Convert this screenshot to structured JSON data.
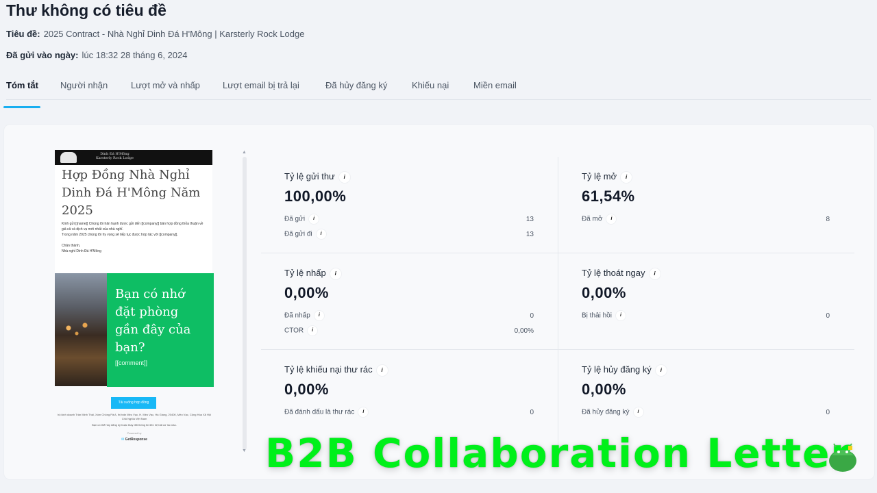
{
  "header": {
    "title": "Thư không có tiêu đề",
    "subject_label": "Tiêu đề:",
    "subject_value": "2025 Contract - Nhà Nghỉ Dinh Đá H'Mông | Karsterly Rock Lodge",
    "sent_label": "Đã gửi vào ngày:",
    "sent_value": "lúc 18:32 28 tháng 6, 2024"
  },
  "tabs": [
    "Tóm tắt",
    "Người nhận",
    "Lượt mở và nhấp",
    "Lượt email bị trả lại",
    "Đã hủy đăng ký",
    "Khiếu nại",
    "Miền email"
  ],
  "active_tab": "Tóm tắt",
  "preview": {
    "brand": "Dinh Đá H'Mông\nKarsterly Rock Lodge",
    "heading": "Hợp Đồng Nhà Nghỉ Dinh Đá H'Mông Năm 2025",
    "body_line1": "Kính gửi [[name]] Chúng tôi hân hạnh được gửi đến [[company]] bản hợp đồng thỏa thuận về giá cả và dịch vụ mới nhất của nhà nghỉ.",
    "body_line2": "Trong năm 2025 chúng tôi hy vọng sẽ tiếp tục được hợp tác với [[company]].",
    "body_line3": "Chân thành,",
    "body_line4": "Nhà nghỉ Dinh Đá H'Mông",
    "green_title": "Bạn có nhớ đặt phòng gần đây của bạn?",
    "green_comment": "[[comment]]",
    "button": "Tải xuống hợp đồng",
    "footer1": "hộ kinh doanh Trần Minh Thái, Xóm Chông Pả A, thị trấn Mèo Vạc, H. Mèo Vạc, Hà Giang, 20400, Mèo Vạc, Cộng Hòa Xã Hội Chủ Nghĩa Việt Nam",
    "footer2": "Bạn có thể hủy đăng ký hoặc thay đổi thông tin liên hệ bất cứ lúc nào.",
    "footer3": "Powered by",
    "footer4": "GetResponse"
  },
  "stats": {
    "delivery": {
      "label": "Tỷ lệ gửi thư",
      "value": "100,00%",
      "sub1_label": "Đã gửi",
      "sub1_value": "13",
      "sub2_label": "Đã gửi đi",
      "sub2_value": "13"
    },
    "open": {
      "label": "Tỷ lệ mở",
      "value": "61,54%",
      "sub1_label": "Đã mở",
      "sub1_value": "8"
    },
    "click": {
      "label": "Tỷ lệ nhấp",
      "value": "0,00%",
      "sub1_label": "Đã nhấp",
      "sub1_value": "0",
      "sub2_label": "CTOR",
      "sub2_value": "0,00%"
    },
    "bounce": {
      "label": "Tỷ lệ thoát ngay",
      "value": "0,00%",
      "sub1_label": "Bị thải hồi",
      "sub1_value": "0"
    },
    "spam": {
      "label": "Tỷ lệ khiếu nại thư rác",
      "value": "0,00%",
      "sub1_label": "Đã đánh dấu là thư rác",
      "sub1_value": "0"
    },
    "unsub": {
      "label": "Tỷ lệ hủy đăng ký",
      "value": "0,00%",
      "sub1_label": "Đã hủy đăng ký",
      "sub1_value": "0"
    }
  },
  "info_glyph": "i",
  "banner": "B2B Collaboration Letter",
  "colors": {
    "accent": "#19aef0",
    "green": "#0ebe64",
    "banner": "#00f01a"
  }
}
